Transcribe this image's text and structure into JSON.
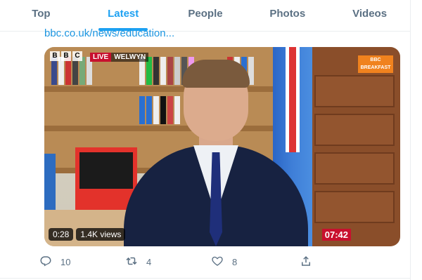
{
  "tabs": [
    {
      "label": "Top",
      "active": false
    },
    {
      "label": "Latest",
      "active": true
    },
    {
      "label": "People",
      "active": false
    },
    {
      "label": "Photos",
      "active": false
    },
    {
      "label": "Videos",
      "active": false
    }
  ],
  "tweet": {
    "link_text": "bbc.co.uk/news/education...",
    "video": {
      "duration": "0:28",
      "views": "1.4K views",
      "channel_logo": [
        "B",
        "B",
        "C"
      ],
      "live_label": "LIVE",
      "location_label": "WELWYN",
      "badge_line1": "BBC",
      "badge_line2": "BREAKFAST",
      "clock": "07:42"
    },
    "actions": {
      "replies": "10",
      "retweets": "4",
      "likes": "8"
    }
  },
  "colors": {
    "accent": "#1da1f2",
    "muted": "#5b7083",
    "live_red": "#c8102e"
  }
}
